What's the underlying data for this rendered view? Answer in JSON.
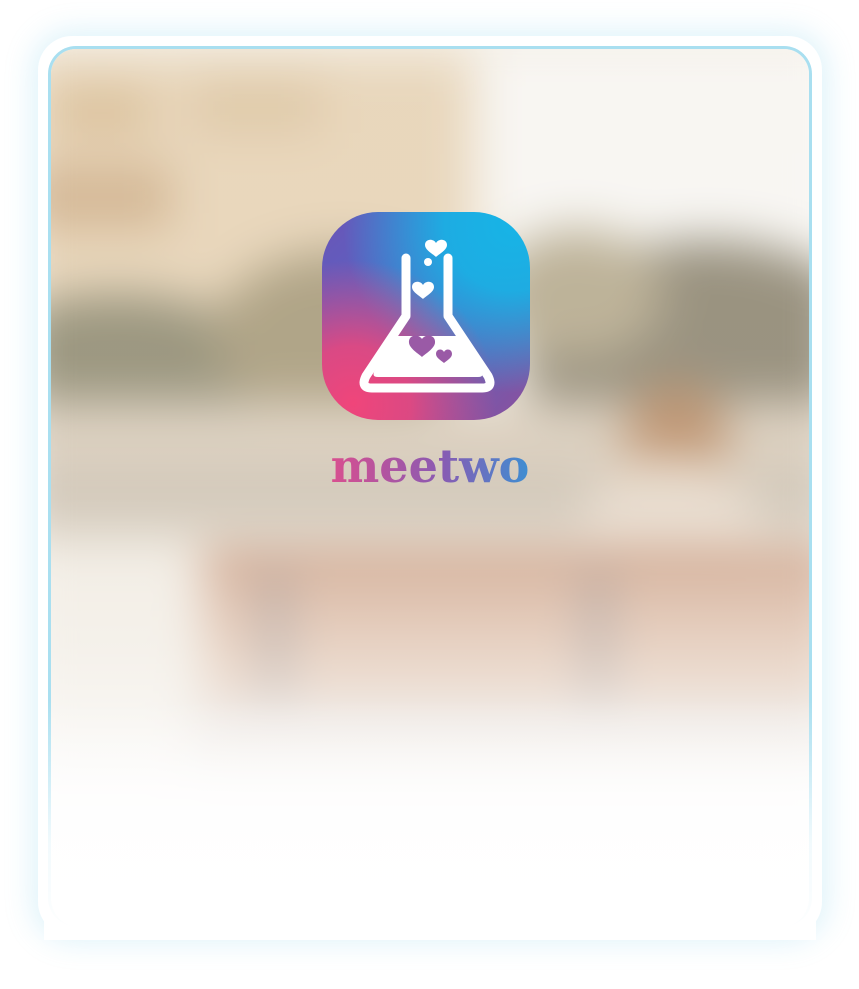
{
  "brand": {
    "name": "meetwo",
    "colors": {
      "pink": "#f0457a",
      "purple": "#6a55b8",
      "cyan": "#17b4e6",
      "frame_border": "#a9dff0"
    },
    "icon": "flask-hearts-icon"
  },
  "background": {
    "description_icon": "blurred-photo-background"
  }
}
